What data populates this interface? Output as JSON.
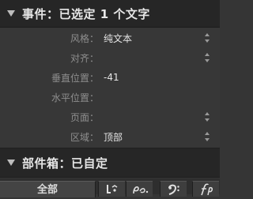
{
  "events_section": {
    "title": "事件：已选定 1 个文字"
  },
  "properties": [
    {
      "label": "风格：",
      "value": "纯文本",
      "has_stepper": true
    },
    {
      "label": "对齐：",
      "value": "",
      "has_stepper": true
    },
    {
      "label": "垂直位置：",
      "value": "-41",
      "has_stepper": false
    },
    {
      "label": "水平位置：",
      "value": "",
      "has_stepper": false
    },
    {
      "label": "页面：",
      "value": "",
      "has_stepper": true
    },
    {
      "label": "区域：",
      "value": "顶部",
      "has_stepper": true
    }
  ],
  "parts_section": {
    "title": "部件箱：已自定"
  },
  "toolbar": {
    "all_tab_label": "全部",
    "buttons": [
      {
        "icon": "pedal-bracket-icon"
      },
      {
        "icon": "pedal-ped-icon"
      },
      {
        "icon": "bass-clef-icon"
      },
      {
        "icon": "fp-dynamic-icon"
      }
    ]
  }
}
